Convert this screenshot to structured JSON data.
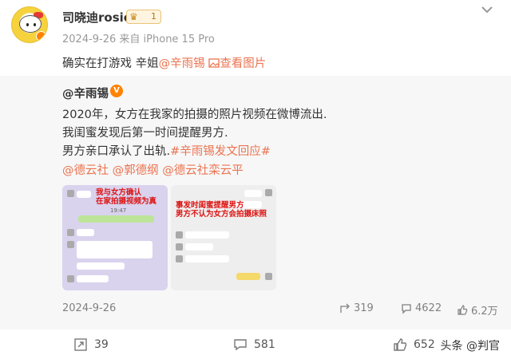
{
  "post": {
    "author": "司晓迪rosie",
    "member_level": "1",
    "meta": "2024-9-26 来自 iPhone 15 Pro",
    "text_before": "确实在打游戏 辛姐",
    "mention": "@辛雨锡",
    "image_link": "查看图片"
  },
  "repost": {
    "author": "@辛雨锡",
    "verified_badge": "V",
    "lines": [
      "2020年，女方在我家的拍摄的照片视频在微博流出.",
      "我闺蜜发现后第一时间提醒男方.",
      "男方亲口承认了出轨."
    ],
    "hashtag": "#辛雨锡发文回应#",
    "mentions": [
      "@德云社",
      "@郭德纲",
      "@德云社栾云平"
    ],
    "images": [
      {
        "caption_top": "我与女方确认",
        "caption_mid": "在家拍摄视频为真",
        "time": "19:47"
      },
      {
        "caption_top": "事发时闺蜜提醒男方",
        "caption_mid": "男方不认为女方会拍摄床照"
      }
    ],
    "date": "2024-9-26",
    "reposts": "319",
    "comments": "4622",
    "likes": "6.2万"
  },
  "actions": {
    "share": "39",
    "comment": "581",
    "like": "652"
  },
  "watermark": "头条 @判官",
  "colors": {
    "link": "#eb7350",
    "card_bg": "#f7f7f7",
    "meta": "#999999",
    "vip": "#ff8200"
  }
}
